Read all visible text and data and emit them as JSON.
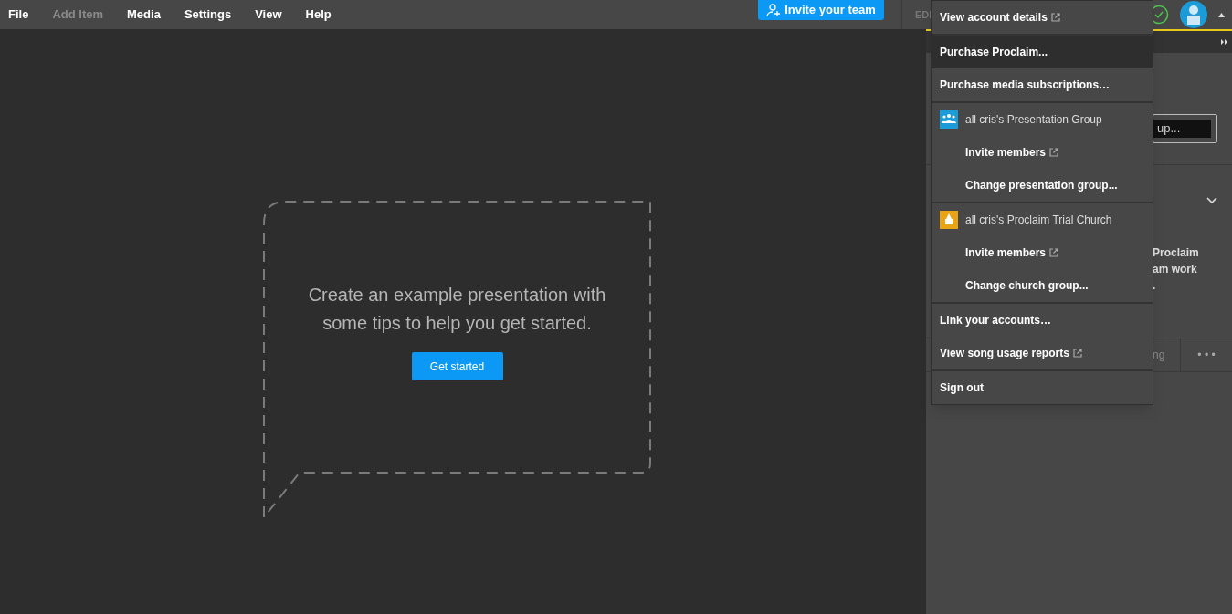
{
  "menubar": [
    {
      "label": "File",
      "disabled": false
    },
    {
      "label": "Add Item",
      "disabled": true
    },
    {
      "label": "Media",
      "disabled": false
    },
    {
      "label": "Settings",
      "disabled": false
    },
    {
      "label": "View",
      "disabled": false
    },
    {
      "label": "Help",
      "disabled": false
    }
  ],
  "invite_button": "Invite your team",
  "tab_label": "EDI",
  "empty_state": {
    "message": "Create an example presentation with some tips to help you get started.",
    "button": "Get started"
  },
  "side_panel": {
    "field_value": "up...",
    "text_lines": [
      "Proclaim",
      "am work",
      "."
    ],
    "tab_label": "ng",
    "more": "• • •"
  },
  "account_menu": {
    "sections": [
      [
        {
          "kind": "action",
          "label": "View account details",
          "external": true,
          "highlighted": false
        }
      ],
      [
        {
          "kind": "action",
          "label": "Purchase Proclaim...",
          "external": false,
          "highlighted": true
        },
        {
          "kind": "action",
          "label": "Purchase media subscriptions…",
          "external": false,
          "highlighted": false
        }
      ],
      [
        {
          "kind": "team",
          "label": "all cris's Presentation Group",
          "color": "#1b9bd7",
          "external": false,
          "highlighted": false
        },
        {
          "kind": "sub",
          "label": "Invite members",
          "external": true,
          "highlighted": false
        },
        {
          "kind": "sub",
          "label": "Change presentation group...",
          "external": false,
          "highlighted": false
        }
      ],
      [
        {
          "kind": "church",
          "label": "all cris's Proclaim Trial Church",
          "color": "#e8a317",
          "external": false,
          "highlighted": false
        },
        {
          "kind": "sub",
          "label": "Invite members",
          "external": true,
          "highlighted": false
        },
        {
          "kind": "sub",
          "label": "Change church group...",
          "external": false,
          "highlighted": false
        }
      ],
      [
        {
          "kind": "action",
          "label": "Link your accounts…",
          "external": false,
          "highlighted": false
        },
        {
          "kind": "action",
          "label": "View song usage reports",
          "external": true,
          "highlighted": false
        }
      ],
      [
        {
          "kind": "action",
          "label": "Sign out",
          "external": false,
          "highlighted": false
        }
      ]
    ]
  }
}
